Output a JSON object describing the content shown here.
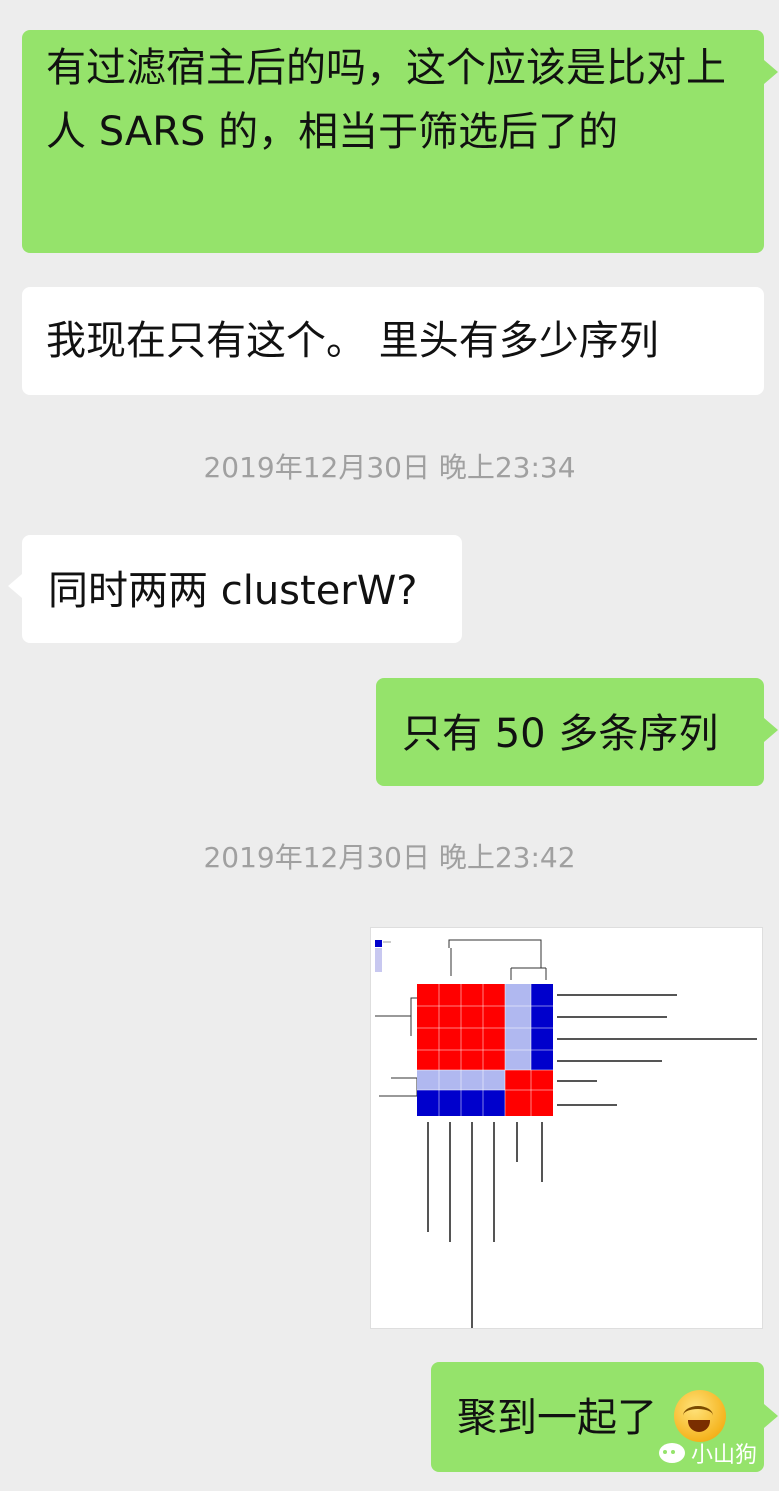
{
  "messages": [
    {
      "text": "有过滤宿主后的吗，这个应该是比对上人 SARS 的，相当于筛选后了的"
    },
    {
      "text": "我现在只有这个。 里头有多少序列"
    },
    {
      "text": "同时两两 clusterW?"
    },
    {
      "text": "只有 50 多条序列"
    },
    {
      "text": "聚到一起了"
    }
  ],
  "timestamps": [
    "2019年12月30日 晚上23:34",
    "2019年12月30日 晚上23:42"
  ],
  "heatmap_image": {
    "values_row_1": [
      "1",
      "1",
      "1",
      "1",
      "0.00",
      "0.00"
    ],
    "emoji": "face-with-tears-of-joy-icon"
  },
  "watermark": {
    "label": "小山狗"
  }
}
